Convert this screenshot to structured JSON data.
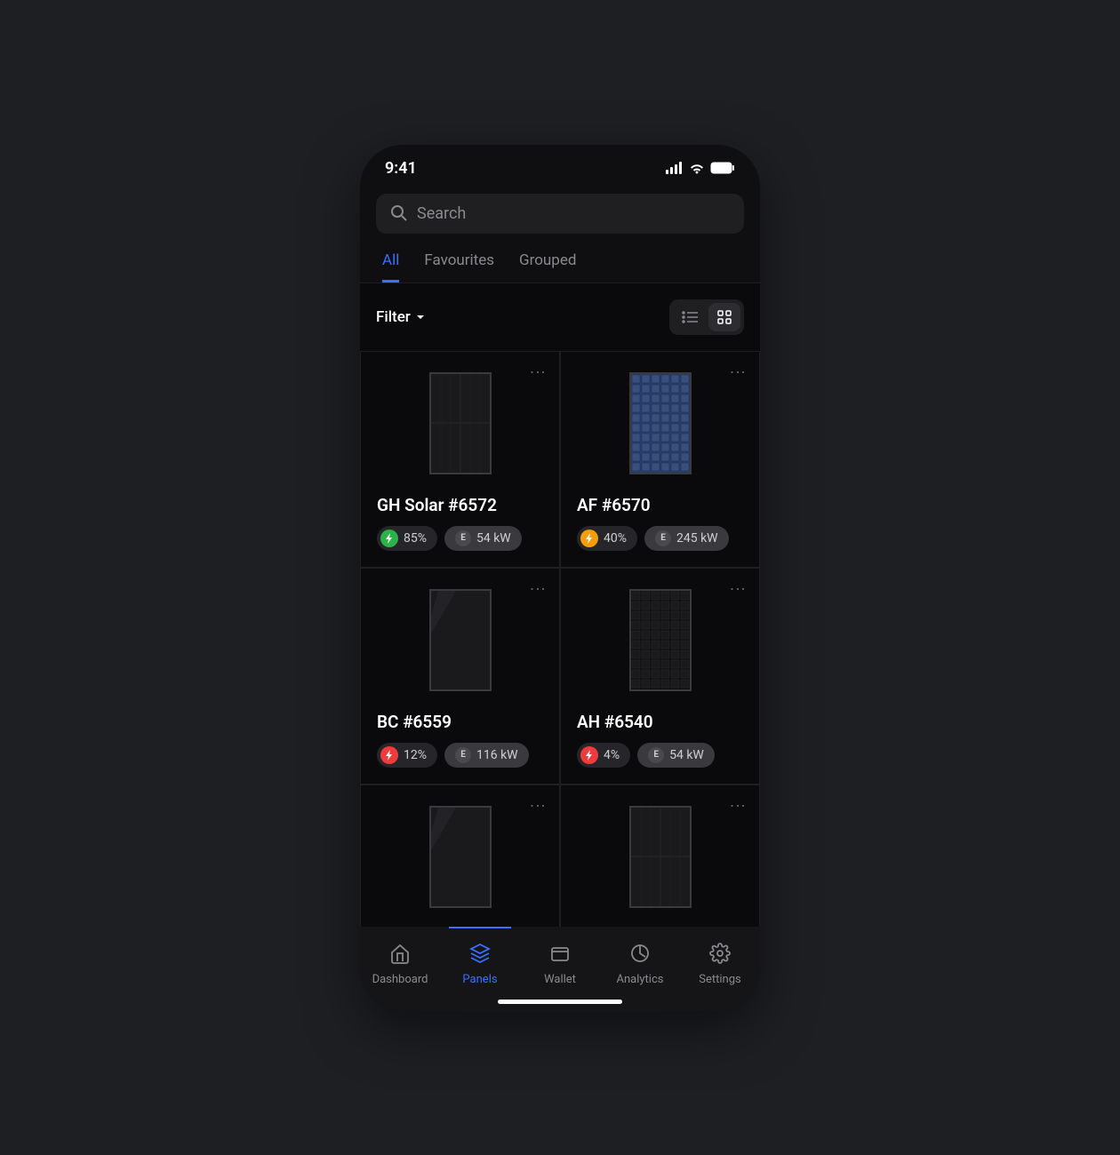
{
  "status": {
    "time": "9:41"
  },
  "search": {
    "placeholder": "Search"
  },
  "tabs": [
    {
      "label": "All",
      "active": true
    },
    {
      "label": "Favourites",
      "active": false
    },
    {
      "label": "Grouped",
      "active": false
    }
  ],
  "filter": {
    "label": "Filter"
  },
  "view": {
    "mode": "grid"
  },
  "panels": [
    {
      "name": "GH Solar #6572",
      "charge": "85%",
      "charge_color": "#2bb34a",
      "energy_label": "E",
      "energy": "54 kW",
      "panel_color": "#1a1a1c",
      "panel_style": "dark"
    },
    {
      "name": "AF #6570",
      "charge": "40%",
      "charge_color": "#f59e0b",
      "energy_label": "E",
      "energy": "245 kW",
      "panel_color": "#2b3f6b",
      "panel_style": "blue"
    },
    {
      "name": "BC #6559",
      "charge": "12%",
      "charge_color": "#ef3b3b",
      "energy_label": "E",
      "energy": "116 kW",
      "panel_color": "#1a1a1c",
      "panel_style": "gloss"
    },
    {
      "name": "AH #6540",
      "charge": "4%",
      "charge_color": "#ef3b3b",
      "energy_label": "E",
      "energy": "54 kW",
      "panel_color": "#1a1a1c",
      "panel_style": "cells"
    },
    {
      "name": "",
      "charge": "",
      "charge_color": "",
      "energy_label": "",
      "energy": "",
      "panel_color": "#1a1a1c",
      "panel_style": "gloss"
    },
    {
      "name": "",
      "charge": "",
      "charge_color": "",
      "energy_label": "",
      "energy": "",
      "panel_color": "#1a1a1c",
      "panel_style": "dark"
    }
  ],
  "nav": [
    {
      "label": "Dashboard",
      "icon": "home",
      "active": false
    },
    {
      "label": "Panels",
      "icon": "layers",
      "active": true
    },
    {
      "label": "Wallet",
      "icon": "wallet",
      "active": false
    },
    {
      "label": "Analytics",
      "icon": "chart",
      "active": false
    },
    {
      "label": "Settings",
      "icon": "gear",
      "active": false
    }
  ]
}
